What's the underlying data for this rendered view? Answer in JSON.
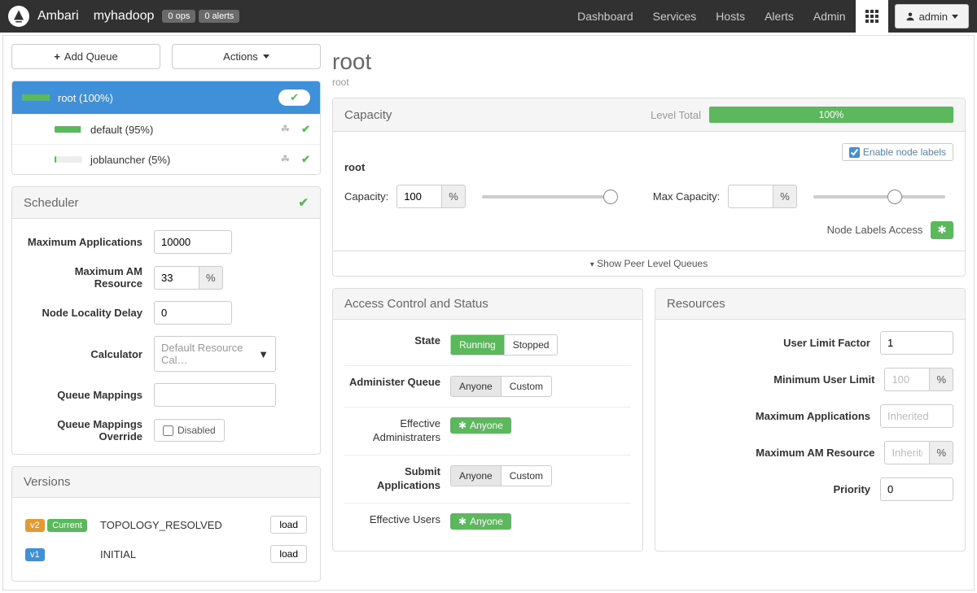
{
  "nav": {
    "brand": "Ambari",
    "cluster": "myhadoop",
    "badges": [
      "0 ops",
      "0 alerts"
    ],
    "links": [
      "Dashboard",
      "Services",
      "Hosts",
      "Alerts",
      "Admin"
    ],
    "admin_label": "admin"
  },
  "left": {
    "add_queue": "Add Queue",
    "actions": "Actions",
    "queues": {
      "root": {
        "label": "root (100%)",
        "fill": 100
      },
      "default": {
        "label": "default (95%)",
        "fill": 95
      },
      "joblauncher": {
        "label": "joblauncher (5%)",
        "fill": 5
      }
    },
    "scheduler": {
      "title": "Scheduler",
      "max_apps_label": "Maximum Applications",
      "max_apps_value": "10000",
      "max_am_label": "Maximum AM Resource",
      "max_am_value": "33",
      "node_locality_label": "Node Locality Delay",
      "node_locality_value": "0",
      "calculator_label": "Calculator",
      "calculator_value": "Default Resource Cal…",
      "mappings_label": "Queue Mappings",
      "override_label": "Queue Mappings Override",
      "override_checkbox": "Disabled"
    },
    "versions": {
      "title": "Versions",
      "rows": [
        {
          "tag": "v2",
          "current": "Current",
          "state": "TOPOLOGY_RESOLVED",
          "action": "load"
        },
        {
          "tag": "v1",
          "current": "",
          "state": "INITIAL",
          "action": "load"
        }
      ]
    }
  },
  "right": {
    "title": "root",
    "breadcrumb": "root",
    "capacity": {
      "title": "Capacity",
      "level_total_label": "Level Total",
      "level_total_pct": "100%",
      "queue_name": "root",
      "enable_labels": "Enable node labels",
      "capacity_label": "Capacity:",
      "capacity_value": "100",
      "max_capacity_label": "Max Capacity:",
      "max_capacity_value": "",
      "node_labels_access": "Node Labels Access",
      "peer_toggle": "Show Peer Level Queues"
    },
    "acl": {
      "title": "Access Control and Status",
      "state_label": "State",
      "running": "Running",
      "stopped": "Stopped",
      "admin_queue_label": "Administer Queue",
      "anyone": "Anyone",
      "custom": "Custom",
      "eff_admin_label": "Effective Administraters",
      "submit_label": "Submit Applications",
      "eff_users_label": "Effective Users"
    },
    "resources": {
      "title": "Resources",
      "user_limit_factor_label": "User Limit Factor",
      "user_limit_factor_value": "1",
      "min_user_limit_label": "Minimum User Limit",
      "min_user_limit_placeholder": "100",
      "max_apps_label": "Maximum Applications",
      "max_apps_placeholder": "Inherited",
      "max_am_label": "Maximum AM Resource",
      "max_am_placeholder": "Inherite",
      "priority_label": "Priority",
      "priority_value": "0"
    }
  }
}
